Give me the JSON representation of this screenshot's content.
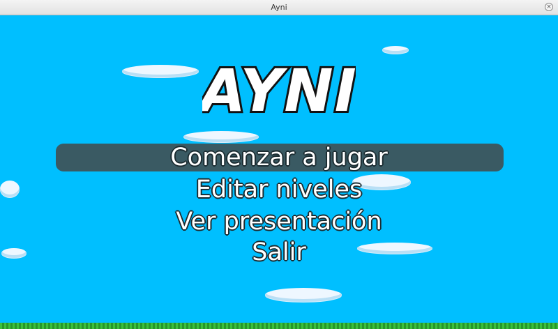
{
  "window": {
    "title": "Ayni",
    "close_glyph": "×"
  },
  "logo": {
    "text": "AYNI"
  },
  "menu": {
    "items": [
      {
        "label": "Comenzar a jugar",
        "selected": true
      },
      {
        "label": "Editar niveles",
        "selected": false
      },
      {
        "label": "Ver presentación",
        "selected": false
      },
      {
        "label": "Salir",
        "selected": false
      }
    ]
  },
  "colors": {
    "sky": "#00bfff",
    "highlight": "#3a5a63",
    "text": "#ffffff",
    "cloud": "#eef7ff",
    "grass": "#2fae2f"
  }
}
